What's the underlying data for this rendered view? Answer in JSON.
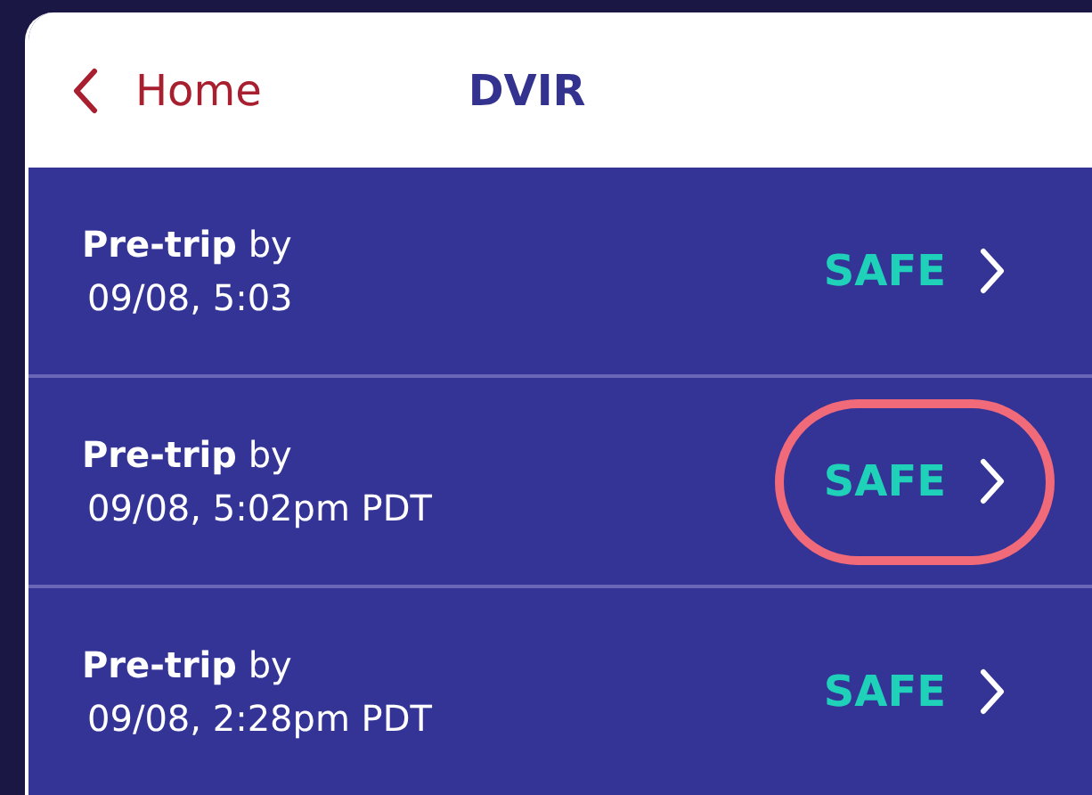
{
  "header": {
    "back_label": "Home",
    "title": "DVIR"
  },
  "reports": [
    {
      "title": "**Pre-trip** by",
      "time": "09/08, 5:03",
      "status": "SAFE",
      "highlighted": false
    },
    {
      "title": "**Pre-trip** by",
      "time": "09/08, 5:02pm PDT",
      "status": "SAFE",
      "highlighted": true
    },
    {
      "title": "**Pre-trip** by",
      "time": "09/08, 2:28pm PDT",
      "status": "SAFE",
      "highlighted": false
    }
  ]
}
